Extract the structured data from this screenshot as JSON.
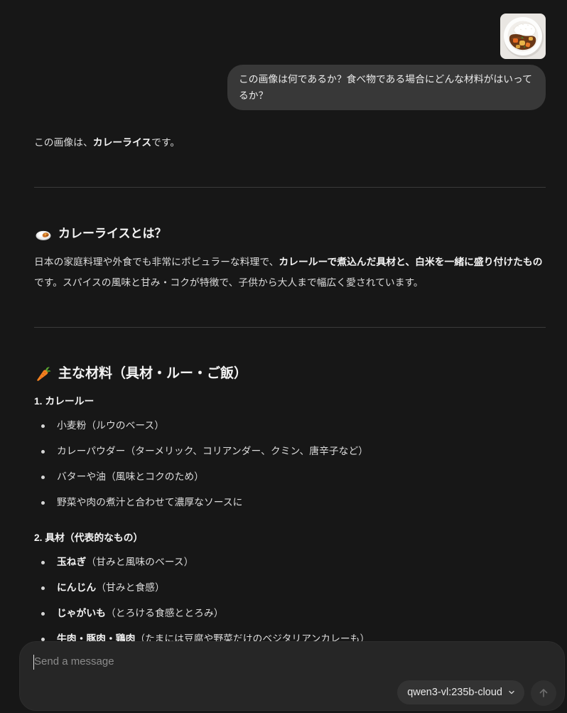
{
  "colors": {
    "background": "#171717",
    "text": "#dcdcdc",
    "text_strong": "#f3f3f3",
    "user_bubble": "#383838",
    "divider": "#3a3a3a",
    "composer_bg": "#262626",
    "placeholder": "#8b8b8b",
    "model_pill": "#333333",
    "send_button": "#2f2f2f",
    "send_icon": "#6e6e6e"
  },
  "user_message": {
    "text": "この画像は何であるか？食べ物である場合にどんな材料がはいってるか？"
  },
  "assistant_message": {
    "intro": [
      "この画像は、",
      "カレーライス",
      "です。"
    ],
    "about": {
      "icon": "curry-rice-icon",
      "heading": "カレーライスとは？",
      "body": [
        "日本の家庭料理や外食でも非常にポピュラーな料理で、",
        "カレールーで煮込んだ具材と、白米を一緒に盛り付けたもの",
        "です。スパイスの風味と甘み・コクが特徴で、子供から大人まで幅広く愛されています。"
      ]
    },
    "ingredients": {
      "icon": "carrot-icon",
      "heading": "主な材料（具材・ルー・ご飯）",
      "groups": [
        {
          "title": "1. カレールー",
          "items": [
            {
              "text": "小麦粉（ルウのベース）"
            },
            {
              "text": "カレーパウダー（ターメリック、コリアンダー、クミン、唐辛子など）"
            },
            {
              "text": "バターや油（風味とコクのため）"
            },
            {
              "text": "野菜や肉の煮汁と合わせて濃厚なソースに"
            }
          ]
        },
        {
          "title": "2. 具材（代表的なもの）",
          "items": [
            {
              "name": "玉ねぎ",
              "note": "（甘みと風味のベース）"
            },
            {
              "name": "にんじん",
              "note": "（甘みと食感）"
            },
            {
              "name": "じゃがいも",
              "note": "（とろける食感ととろみ）"
            },
            {
              "name": "牛肉・豚肉・鶏肉",
              "note": "（たまには豆腐や野菜だけのベジタリアンカレーも）"
            }
          ]
        }
      ]
    }
  },
  "composer": {
    "placeholder": "Send a message",
    "value": "",
    "model": "qwen3-vl:235b-cloud",
    "model_chevron_icon": "chevron-down-icon",
    "send_button_icon": "arrow-up-icon",
    "send_enabled": false
  }
}
